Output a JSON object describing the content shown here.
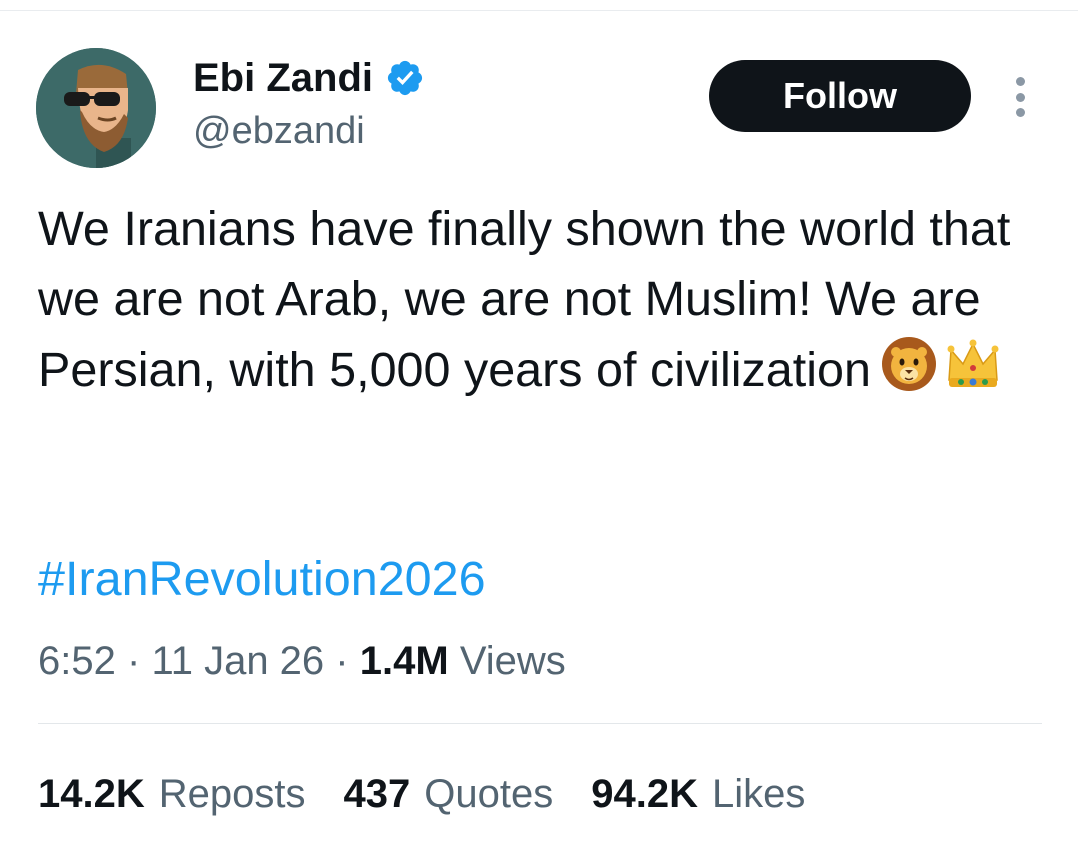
{
  "author": {
    "display_name": "Ebi Zandi",
    "handle": "@ebzandi",
    "verified": true
  },
  "actions": {
    "follow_label": "Follow"
  },
  "tweet": {
    "text": "We Iranians have finally shown the world that we are not Arab, we are not Muslim! We are Persian, with 5,000 years of civilization",
    "emojis": [
      "lion-face-emoji",
      "crown-emoji"
    ],
    "hashtag": "#IranRevolution2026",
    "time": "6:52",
    "separator": "·",
    "date": "11 Jan 26",
    "views_count": "1.4M",
    "views_label": "Views"
  },
  "stats": {
    "reposts_count": "14.2K",
    "reposts_label": "Reposts",
    "quotes_count": "437",
    "quotes_label": "Quotes",
    "likes_count": "94.2K",
    "likes_label": "Likes"
  },
  "colors": {
    "text": "#0f1419",
    "secondary": "#536471",
    "link": "#1d9bf0",
    "verified": "#1d9bf0",
    "avatar_bg": "#3d6a68",
    "follow_bg": "#0f1419"
  }
}
